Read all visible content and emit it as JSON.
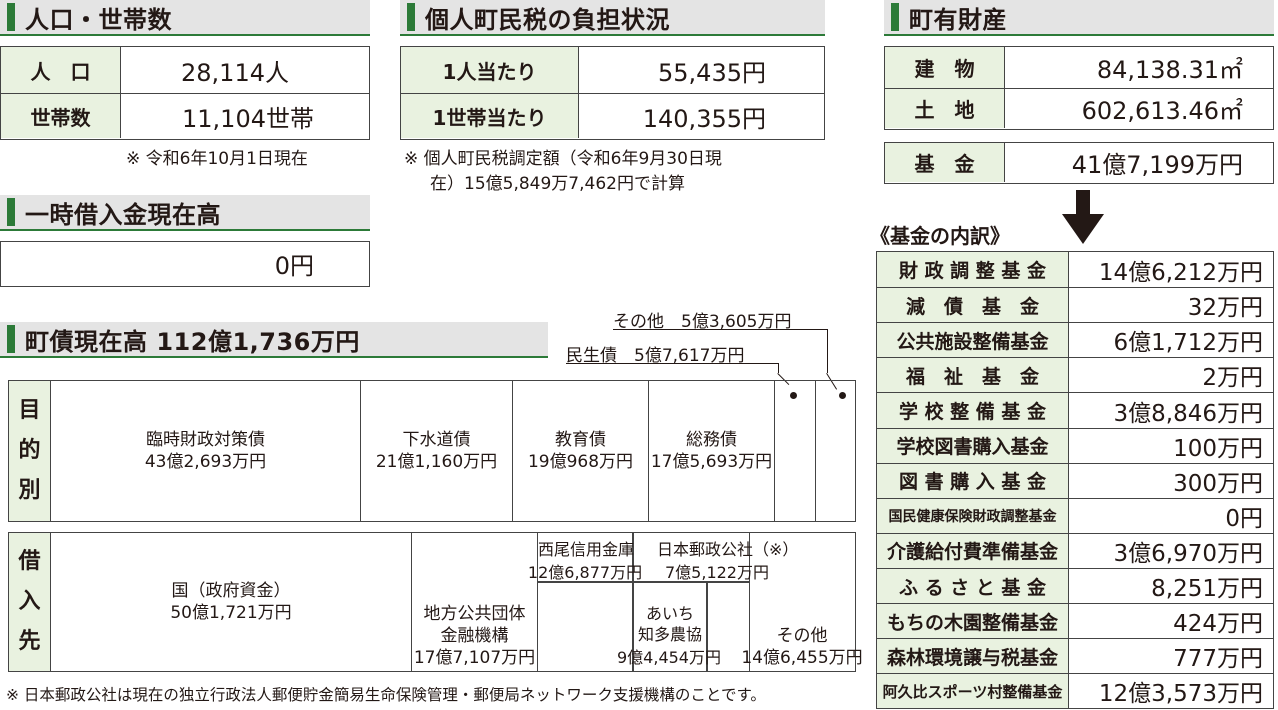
{
  "population": {
    "heading": "人口・世帯数",
    "rows": [
      {
        "label": "人　口",
        "value": "28,114人"
      },
      {
        "label": "世帯数",
        "value": "11,104世帯"
      }
    ],
    "note": "※ 令和6年10月1日現在"
  },
  "tax": {
    "heading": "個人町民税の負担状況",
    "rows": [
      {
        "label": "1人当たり",
        "value": "55,435円"
      },
      {
        "label": "1世帯当たり",
        "value": "140,355円"
      }
    ],
    "note_line1": "※ 個人町民税調定額（令和6年9月30日現",
    "note_line2": "在）15億5,849万7,462円で計算"
  },
  "property": {
    "heading": "町有財産",
    "rows": [
      {
        "label": "建　物",
        "value": "84,138.31㎡"
      },
      {
        "label": "土　地",
        "value": "602,613.46㎡"
      }
    ],
    "fund": {
      "label": "基　金",
      "value": "41億7,199万円"
    }
  },
  "loan": {
    "heading": "一時借入金現在高",
    "value": "0円"
  },
  "debt": {
    "heading": "町債現在高 112億1,736万円",
    "other_label": "その他　5億3,605万円",
    "minsei_label": "民生債　5億7,617万円",
    "purpose": {
      "label_chars": [
        "目",
        "的",
        "別"
      ],
      "items": [
        {
          "name": "臨時財政対策債",
          "amount": "43億2,693万円"
        },
        {
          "name": "下水道債",
          "amount": "21億1,160万円"
        },
        {
          "name": "教育債",
          "amount": "19億968万円"
        },
        {
          "name": "総務債",
          "amount": "17億5,693万円"
        }
      ]
    },
    "lenders": {
      "label_chars": [
        "借",
        "入",
        "先"
      ],
      "national": {
        "name": "国（政府資金）",
        "amount": "50億1,721万円"
      },
      "local_finance": {
        "name1": "地方公共団体",
        "name2": "金融機構",
        "amount": "17億7,107万円"
      },
      "nishio": {
        "name": "西尾信用金庫",
        "amount": "12億6,877万円"
      },
      "postal": {
        "name": "日本郵政公社（※）",
        "amount": "7億5,122万円"
      },
      "aichi": {
        "name1": "あいち",
        "name2": "知多農協",
        "amount": "9億4,454万円"
      },
      "other": {
        "name": "その他",
        "amount": "14億6,455万円"
      }
    },
    "footnote": "※ 日本郵政公社は現在の独立行政法人郵便貯金簡易生命保険管理・郵便局ネットワーク支援機構のことです。"
  },
  "funds": {
    "heading": "《基金の内訳》",
    "rows": [
      {
        "label": "財 政 調 整 基 金",
        "value": "14億6,212万円"
      },
      {
        "label": "減　債　基　金",
        "value": "32万円"
      },
      {
        "label": "公共施設整備基金",
        "value": "6億1,712万円"
      },
      {
        "label": "福　祉　基　金",
        "value": "2万円"
      },
      {
        "label": "学 校 整 備 基 金",
        "value": "3億8,846万円"
      },
      {
        "label": "学校図書購入基金",
        "value": "100万円"
      },
      {
        "label": "図 書 購 入 基 金",
        "value": "300万円"
      },
      {
        "label": "国民健康保険財政調整基金",
        "value": "0円"
      },
      {
        "label": "介護給付費準備基金",
        "value": "3億6,970万円"
      },
      {
        "label": "ふ る さ と 基 金",
        "value": "8,251万円"
      },
      {
        "label": "もちの木園整備基金",
        "value": "424万円"
      },
      {
        "label": "森林環境譲与税基金",
        "value": "777万円"
      },
      {
        "label": "阿久比スポーツ村整備基金",
        "value": "12億3,573万円"
      }
    ]
  },
  "colors": {
    "accent_green": "#2c7a38",
    "label_bg": "#e9f2e0",
    "header_bg": "#e4e4e4"
  },
  "icons": {
    "arrow": "down-arrow-icon"
  }
}
